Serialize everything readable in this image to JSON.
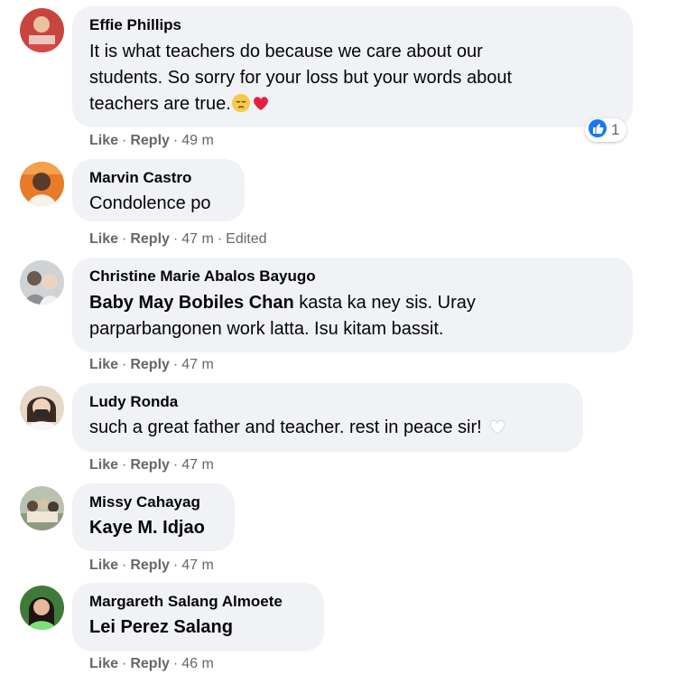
{
  "comments": [
    {
      "author": "Effie Phillips",
      "text_lines": [
        "It is what teachers do because we care about our",
        "students. So sorry for your loss but your words about",
        "teachers are true."
      ],
      "emojis": [
        "pensive-face",
        "red-heart"
      ],
      "reaction": {
        "type": "like",
        "count": "1"
      },
      "like": "Like",
      "reply": "Reply",
      "time": "49 m"
    },
    {
      "author": "Marvin Castro",
      "text": "Condolence po",
      "like": "Like",
      "reply": "Reply",
      "time": "47 m",
      "edited": "Edited"
    },
    {
      "author": "Christine Marie Abalos Bayugo",
      "mention": "Baby May Bobiles Chan",
      "text_line1_rest": " kasta ka ney sis. Uray",
      "text_line2": "parparbangonen work latta. Isu kitam bassit.",
      "like": "Like",
      "reply": "Reply",
      "time": "47 m"
    },
    {
      "author": "Ludy Ronda",
      "text": "such a great father and teacher. rest in peace sir!",
      "emojis": [
        "white-heart"
      ],
      "like": "Like",
      "reply": "Reply",
      "time": "47 m"
    },
    {
      "author": "Missy Cahayag",
      "mention": "Kaye M. Idjao",
      "like": "Like",
      "reply": "Reply",
      "time": "47 m"
    },
    {
      "author": "Margareth Salang Almoete",
      "mention": "Lei Perez Salang",
      "like": "Like",
      "reply": "Reply",
      "time": "46 m"
    }
  ],
  "colors": {
    "bubble": "#f0f2f5",
    "meta_text": "#65676b",
    "like_blue": "#1877f2",
    "heart_red": "#e41e3f"
  },
  "separator": "·"
}
